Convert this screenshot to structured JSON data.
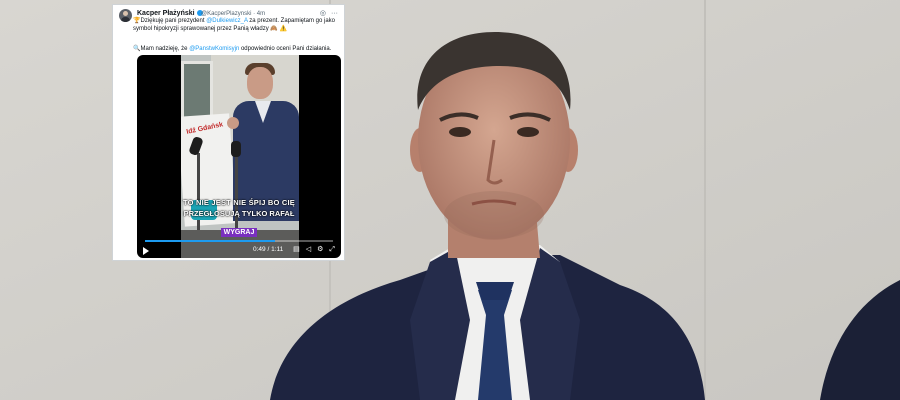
{
  "photo": {
    "description_icon": "portrait-photo",
    "colors": {
      "wall": "#d3d1cc",
      "suit": "#1e2440",
      "tie": "#243a6b",
      "shirt": "#f2f2f2",
      "skin": "#c4957f",
      "hair": "#3a3430"
    }
  },
  "tweet": {
    "author_name": "Kacper Płażyński",
    "handle": "@KacperPlazynski",
    "time": "· 4m",
    "icons": {
      "more": "more-icon",
      "grok": "grok-icon"
    },
    "line1_before": "Dziękuję pani prezydent ",
    "line1_mention": "@Dulkiewicz_A",
    "line1_after": " za prezent. Zapamiętam go jako symbol hipokryzji sprawowanej przez Panią władzy",
    "line2_before": "Mam nadzieję, że ",
    "line2_mention": "@PanstwKomisyjn",
    "line2_after": " odpowiednio oceni Pani działania.",
    "emoji_warning": "⚠️",
    "emoji_trophy": "🏆",
    "emoji_search": "🔍",
    "emoji_box": "🙈"
  },
  "video": {
    "banner_text": "Idź Gdańsk",
    "subtitle_line1": "TO NIE JEST NIE ŚPIJ BO CIĘ",
    "subtitle_line2": "PRZEGŁOSUJĄ TYLKO RAFAŁ",
    "subtitle_line3": "WYGRAJ",
    "time": "0:49 / 1:11",
    "progress": 0.69,
    "icons": {
      "play": "play-icon",
      "cc": "captions-icon",
      "volume": "volume-icon",
      "settings": "settings-icon",
      "fullscreen": "fullscreen-icon"
    }
  }
}
